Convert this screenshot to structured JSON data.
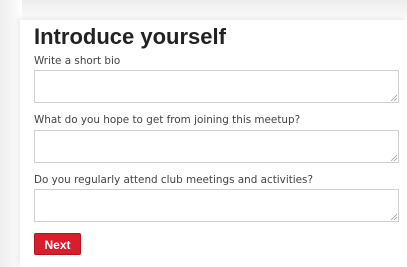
{
  "form": {
    "title": "Introduce yourself",
    "fields": [
      {
        "label": "Write a short bio",
        "value": ""
      },
      {
        "label": "What do you hope to get from joining this meetup?",
        "value": ""
      },
      {
        "label": "Do you regularly attend club meetings and activities?",
        "value": ""
      }
    ],
    "submit_label": "Next"
  },
  "colors": {
    "accent": "#d71e2c",
    "text": "#222222",
    "label": "#444444",
    "border": "#d0d0d0"
  },
  "icons": {
    "textarea_resize": "resize-grip-icon"
  }
}
